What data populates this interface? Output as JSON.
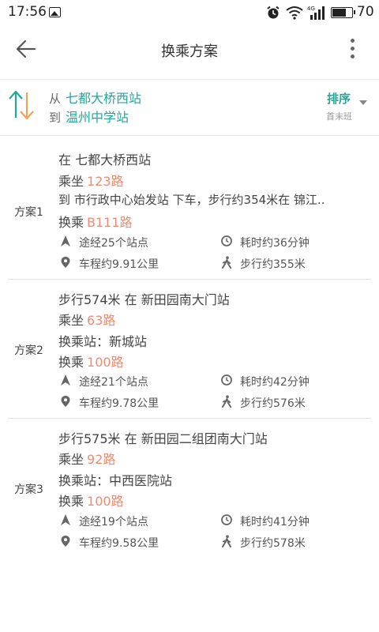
{
  "status_bar": {
    "time": "17:56",
    "network": "4G",
    "battery": "70",
    "icons": [
      "gallery-icon",
      "alarm-icon",
      "wifi-icon",
      "signal-icon",
      "battery-icon"
    ]
  },
  "title_bar": {
    "title": "换乘方案",
    "back_icon": "arrow-left-icon",
    "more_icon": "more-vertical-icon"
  },
  "route": {
    "from_prefix": "从",
    "from_station": "七都大桥西站",
    "to_prefix": "到",
    "to_station": "温州中学站",
    "sort_label": "排序",
    "sort_sub": "首末班",
    "accent_color": "#21a89a"
  },
  "route_color": "#ef8b73",
  "plans": [
    {
      "name": "方案1",
      "lines": [
        {
          "text": "在 七都大桥西站",
          "route": ""
        },
        {
          "text": "乘坐",
          "route": "123路"
        },
        {
          "text": "到 市行政中心始发站 下车，步行约354米在 锦江..",
          "route": ""
        },
        {
          "text": "换乘",
          "route": "B111路"
        }
      ],
      "stops": "途经25个站点",
      "time": "耗时约36分钟",
      "distance": "车程约9.91公里",
      "walk": "步行约355米"
    },
    {
      "name": "方案2",
      "lines": [
        {
          "text": "步行574米 在 新田园南大门站",
          "route": ""
        },
        {
          "text": "乘坐",
          "route": "63路"
        },
        {
          "text": "换乘站：新城站",
          "route": ""
        },
        {
          "text": "换乘",
          "route": "100路"
        }
      ],
      "stops": "途经21个站点",
      "time": "耗时约42分钟",
      "distance": "车程约9.78公里",
      "walk": "步行约576米"
    },
    {
      "name": "方案3",
      "lines": [
        {
          "text": "步行575米 在 新田园二组团南大门站",
          "route": ""
        },
        {
          "text": "乘坐",
          "route": "92路"
        },
        {
          "text": "换乘站：中西医院站",
          "route": ""
        },
        {
          "text": "换乘",
          "route": "100路"
        }
      ],
      "stops": "途经19个站点",
      "time": "耗时约41分钟",
      "distance": "车程约9.58公里",
      "walk": "步行约578米"
    }
  ]
}
